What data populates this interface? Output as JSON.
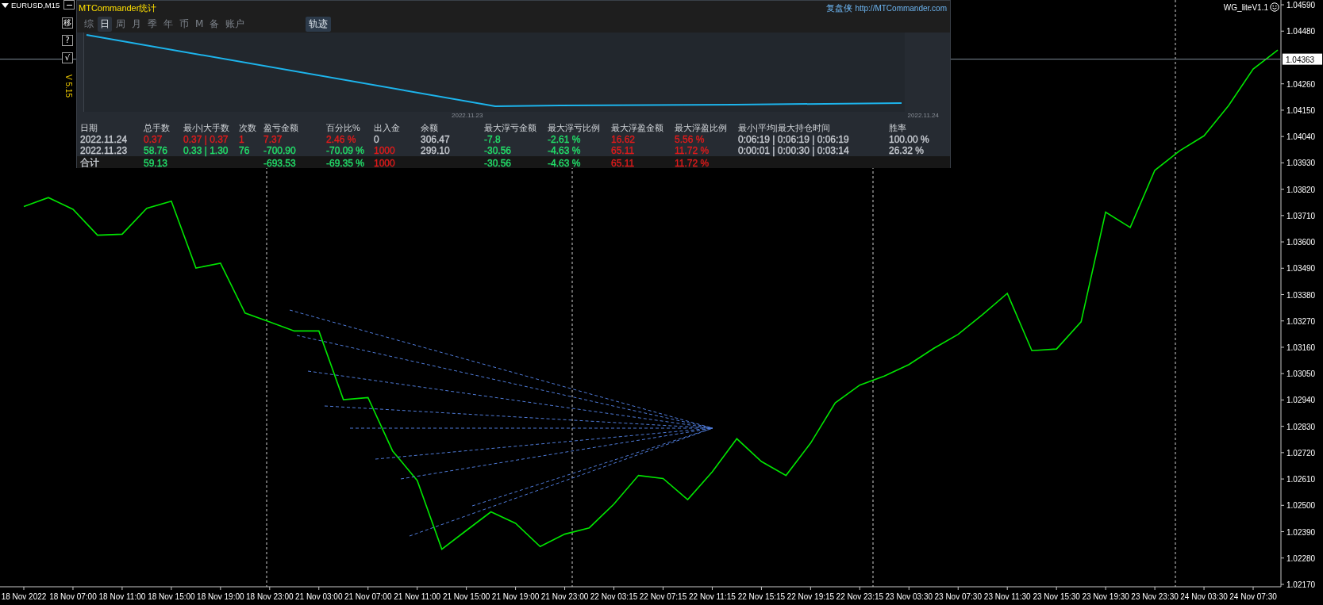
{
  "symbol": {
    "label": "EURUSD,M15"
  },
  "side_buttons": [
    "移",
    "?",
    "√"
  ],
  "version": "V 5.15",
  "indicator_label": "WG_liteV1.1",
  "panel": {
    "title": "MTCommander统计",
    "brand": "复盘侠",
    "link": "http://MTCommander.com",
    "tabs": [
      {
        "label": "综",
        "selected": false
      },
      {
        "label": "日",
        "selected": true
      },
      {
        "label": "周",
        "selected": false
      },
      {
        "label": "月",
        "selected": false
      },
      {
        "label": "季",
        "selected": false
      },
      {
        "label": "年",
        "selected": false
      },
      {
        "label": "币",
        "selected": false
      },
      {
        "label": "M",
        "selected": false
      },
      {
        "label": "备",
        "selected": false
      },
      {
        "label": "账户",
        "selected": false
      }
    ],
    "mode_button": {
      "label": "轨迹",
      "on": true
    },
    "equity_dates": [
      "2022.11.23",
      "2022.11.24"
    ],
    "table": {
      "columns": [
        "日期",
        "总手数",
        "最小|大手数",
        "次数",
        "盈亏金额",
        "百分比%",
        "出入金",
        "余额",
        "最大浮亏金额",
        "最大浮亏比例",
        "最大浮盈金额",
        "最大浮盈比例",
        "最小|平均|最大持仓时间",
        "胜率"
      ],
      "rows": [
        {
          "kind": "day",
          "cells": [
            {
              "text": "2022.11.24",
              "color": "#c8ccd2"
            },
            {
              "text": "0.37",
              "color": "#e31b1b"
            },
            {
              "text": "0.37 | 0.37",
              "color": "#e31b1b"
            },
            {
              "text": "1",
              "color": "#e31b1b"
            },
            {
              "text": "7.37",
              "color": "#e31b1b"
            },
            {
              "text": "2.46 %",
              "color": "#e31b1b"
            },
            {
              "text": "0",
              "color": "#c8ccd2"
            },
            {
              "text": "306.47",
              "color": "#c8ccd2"
            },
            {
              "text": "-7.8",
              "color": "#22e06a"
            },
            {
              "text": "-2.61 %",
              "color": "#22e06a"
            },
            {
              "text": "16.62",
              "color": "#e31b1b"
            },
            {
              "text": "5.56 %",
              "color": "#e31b1b"
            },
            {
              "text": "0:06:19 | 0:06:19 | 0:06:19",
              "color": "#c8ccd2"
            },
            {
              "text": "100.00 %",
              "color": "#c8ccd2"
            }
          ]
        },
        {
          "kind": "day",
          "cells": [
            {
              "text": "2022.11.23",
              "color": "#c8ccd2"
            },
            {
              "text": "58.76",
              "color": "#22e06a"
            },
            {
              "text": "0.33 | 1.30",
              "color": "#22e06a"
            },
            {
              "text": "76",
              "color": "#22e06a"
            },
            {
              "text": "-700.90",
              "color": "#22e06a"
            },
            {
              "text": "-70.09 %",
              "color": "#22e06a"
            },
            {
              "text": "1000",
              "color": "#e31b1b"
            },
            {
              "text": "299.10",
              "color": "#c8ccd2"
            },
            {
              "text": "-30.56",
              "color": "#22e06a"
            },
            {
              "text": "-4.63 %",
              "color": "#22e06a"
            },
            {
              "text": "65.11",
              "color": "#e31b1b"
            },
            {
              "text": "11.72 %",
              "color": "#e31b1b"
            },
            {
              "text": "0:00:01 | 0:00:30 | 0:03:14",
              "color": "#c8ccd2"
            },
            {
              "text": "26.32 %",
              "color": "#c8ccd2"
            }
          ]
        },
        {
          "kind": "total",
          "cells": [
            {
              "text": "合计",
              "color": "#c8ccd2"
            },
            {
              "text": "59.13",
              "color": "#22e06a"
            },
            null,
            null,
            {
              "text": "-693.53",
              "color": "#22e06a"
            },
            {
              "text": "-69.35 %",
              "color": "#22e06a"
            },
            {
              "text": "1000",
              "color": "#e31b1b"
            },
            null,
            {
              "text": "-30.56",
              "color": "#22e06a"
            },
            {
              "text": "-4.63 %",
              "color": "#22e06a"
            },
            {
              "text": "65.11",
              "color": "#e31b1b"
            },
            {
              "text": "11.72 %",
              "color": "#e31b1b"
            },
            null,
            null
          ]
        }
      ]
    }
  },
  "chart": {
    "current_price": "1.04363",
    "chart_data": {
      "type": "line",
      "categories": [
        "18 Nov 2022",
        null,
        "18 Nov 07:00",
        null,
        "18 Nov 11:00",
        null,
        "18 Nov 15:00",
        null,
        "18 Nov 19:00",
        null,
        "18 Nov 23:00",
        null,
        "21 Nov 03:00",
        null,
        "21 Nov 07:00",
        null,
        "21 Nov 11:00",
        null,
        "21 Nov 15:00",
        null,
        "21 Nov 19:00",
        null,
        "21 Nov 23:00",
        null,
        "22 Nov 03:15",
        null,
        "22 Nov 07:15",
        null,
        "22 Nov 11:15",
        null,
        "22 Nov 15:15",
        null,
        "22 Nov 19:15",
        null,
        "22 Nov 23:15",
        null,
        "23 Nov 03:30",
        null,
        "23 Nov 07:30",
        null,
        "23 Nov 11:30",
        null,
        "23 Nov 15:30",
        null,
        "23 Nov 19:30",
        null,
        "23 Nov 23:30",
        null,
        "24 Nov 03:30",
        null,
        "24 Nov 07:30",
        null
      ],
      "series": [
        {
          "color": "#00e600",
          "values": [
            1.03748,
            1.03785,
            1.03736,
            1.03628,
            1.03632,
            1.0374,
            1.0377,
            1.03491,
            1.03511,
            1.03303,
            1.03266,
            1.03228,
            1.03228,
            1.02941,
            1.0295,
            1.02727,
            1.02604,
            1.02317,
            1.02395,
            1.02473,
            1.02425,
            1.02328,
            1.0238,
            1.02406,
            1.02505,
            1.02625,
            1.02612,
            1.02524,
            1.0264,
            1.02778,
            1.02683,
            1.02625,
            1.0276,
            1.02928,
            1.03002,
            1.0304,
            1.03088,
            1.03155,
            1.03214,
            1.03297,
            1.03385,
            1.03146,
            1.03153,
            1.03266,
            1.03724,
            1.0366,
            1.03899,
            1.0398,
            1.04043,
            1.04169,
            1.04322,
            1.04401
          ]
        }
      ],
      "ylim": [
        1.0216,
        1.0461
      ],
      "yticks": [
        {
          "value": 1.0459,
          "label": "1.04590"
        },
        {
          "value": 1.0448,
          "label": "1.04480"
        },
        {
          "value": 1.0426,
          "label": "1.04260"
        },
        {
          "value": 1.0415,
          "label": "1.04150"
        },
        {
          "value": 1.0404,
          "label": "1.04040"
        },
        {
          "value": 1.0393,
          "label": "1.03930"
        },
        {
          "value": 1.0382,
          "label": "1.03820"
        },
        {
          "value": 1.0371,
          "label": "1.03710"
        },
        {
          "value": 1.036,
          "label": "1.03600"
        },
        {
          "value": 1.0349,
          "label": "1.03490"
        },
        {
          "value": 1.0338,
          "label": "1.03380"
        },
        {
          "value": 1.0327,
          "label": "1.03270"
        },
        {
          "value": 1.0316,
          "label": "1.03160"
        },
        {
          "value": 1.0305,
          "label": "1.03050"
        },
        {
          "value": 1.0294,
          "label": "1.02940"
        },
        {
          "value": 1.0283,
          "label": "1.02830"
        },
        {
          "value": 1.0272,
          "label": "1.02720"
        },
        {
          "value": 1.0261,
          "label": "1.02610"
        },
        {
          "value": 1.025,
          "label": "1.02500"
        },
        {
          "value": 1.0239,
          "label": "1.02390"
        },
        {
          "value": 1.0228,
          "label": "1.02280"
        },
        {
          "value": 1.0217,
          "label": "1.02170"
        }
      ]
    }
  }
}
